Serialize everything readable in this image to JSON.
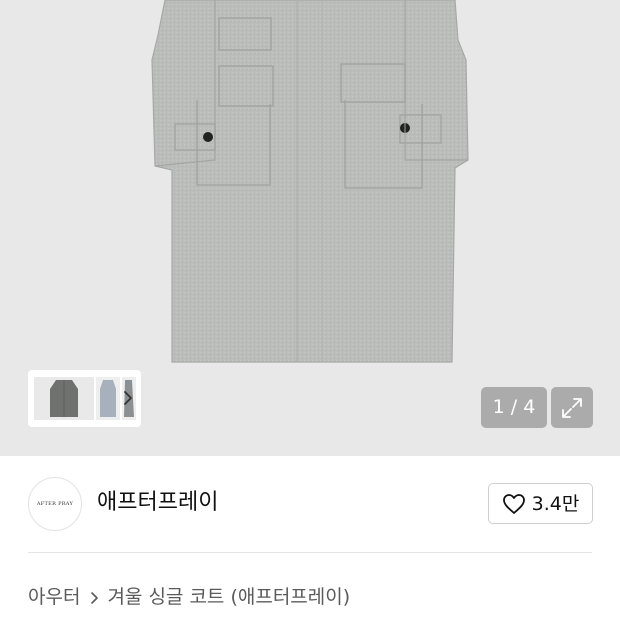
{
  "gallery": {
    "current_page": "1",
    "total_pages": "4",
    "counter_text": "1 / 4",
    "thumbnails": [
      {
        "name": "coat-front-thumbnail"
      },
      {
        "name": "coat-side-thumbnail"
      },
      {
        "name": "coat-detail-thumbnail"
      }
    ],
    "icons": {
      "next": "chevron-right-icon",
      "expand": "expand-arrows-icon"
    }
  },
  "shop": {
    "logo_text": "AFTER PRAY",
    "name": "애프터프레이",
    "like_count": "3.4만",
    "like_icon": "heart-outline-icon"
  },
  "breadcrumb": {
    "category": "아우터",
    "title": "겨울 싱글 코트 (애프터프레이)"
  },
  "colors": {
    "hero_bg": "#e8e8e8",
    "coat_gray": "#b9bcb9",
    "text_primary": "#111111",
    "text_secondary": "#5a5a5a",
    "overlay": "#787878"
  }
}
